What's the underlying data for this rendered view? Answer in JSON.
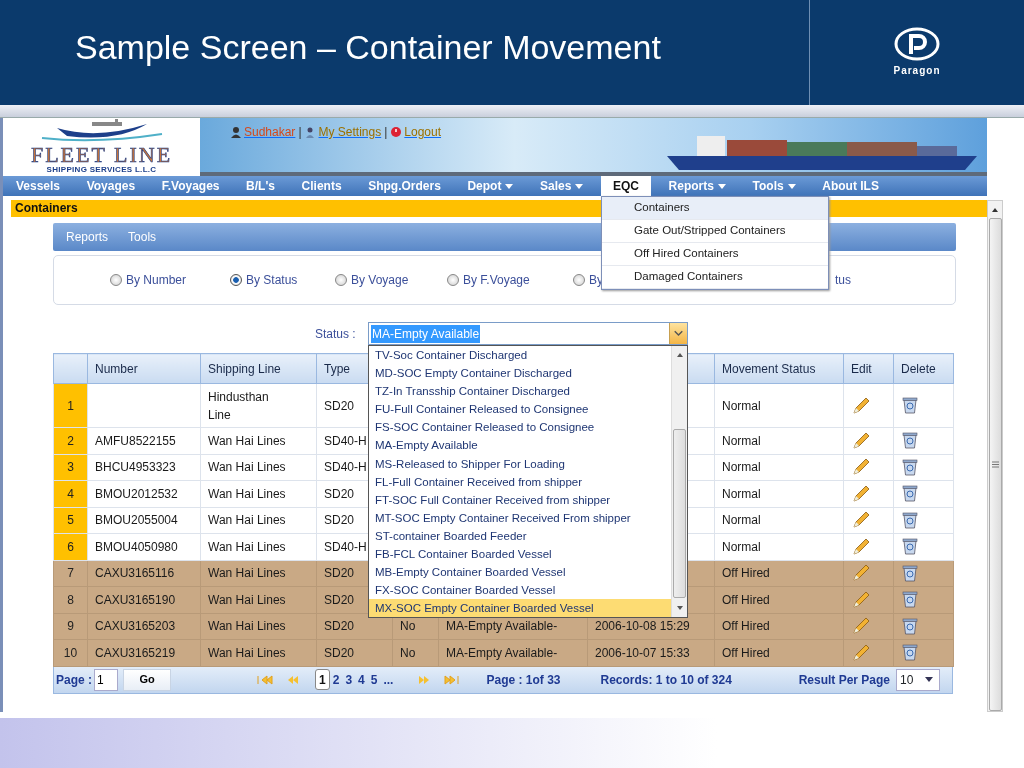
{
  "slide": {
    "title": "Sample Screen – Container Movement",
    "logo_text": "Paragon"
  },
  "app": {
    "logo": {
      "name": "FLEET LINE",
      "tagline": "SHIPPING SERVICES L.L.C"
    },
    "user_links": [
      {
        "kind": "user",
        "label": "Sudhakar"
      },
      {
        "kind": "separator",
        "label": "|"
      },
      {
        "kind": "settings",
        "label": "My Settings"
      },
      {
        "kind": "separator",
        "label": "|"
      },
      {
        "kind": "logout",
        "label": "Logout"
      }
    ],
    "nav": [
      {
        "label": "Vessels",
        "dropdown": false,
        "selected": false
      },
      {
        "label": "Voyages",
        "dropdown": false,
        "selected": false
      },
      {
        "label": "F.Voyages",
        "dropdown": false,
        "selected": false
      },
      {
        "label": "B/L's",
        "dropdown": false,
        "selected": false
      },
      {
        "label": "Clients",
        "dropdown": false,
        "selected": false
      },
      {
        "label": "Shpg.Orders",
        "dropdown": false,
        "selected": false
      },
      {
        "label": "Depot",
        "dropdown": true,
        "selected": false
      },
      {
        "label": "Sales",
        "dropdown": true,
        "selected": false
      },
      {
        "label": "EQC",
        "dropdown": false,
        "selected": true
      },
      {
        "label": "Reports",
        "dropdown": true,
        "selected": false
      },
      {
        "label": "Tools",
        "dropdown": true,
        "selected": false
      },
      {
        "label": "About ILS",
        "dropdown": false,
        "selected": false
      }
    ],
    "eqc_menu": [
      {
        "label": "Containers",
        "highlighted": true
      },
      {
        "label": "Gate Out/Stripped Containers",
        "highlighted": false
      },
      {
        "label": "Off Hired Containers",
        "highlighted": false
      },
      {
        "label": "Damaged Containers",
        "highlighted": false
      }
    ],
    "section_title": "Containers",
    "toolbar": [
      "Reports",
      "Tools"
    ],
    "search_by": [
      {
        "kind": "radio",
        "label": "By Number",
        "selected": false
      },
      {
        "kind": "radio",
        "label": "By Status",
        "selected": true
      },
      {
        "kind": "radio",
        "label": "By Voyage",
        "selected": false
      },
      {
        "kind": "radio",
        "label": "By F.Voyage",
        "selected": false
      },
      {
        "kind": "radio",
        "label": "By",
        "selected": false
      },
      {
        "kind": "text",
        "label": "tus"
      }
    ],
    "status_filter": {
      "label": "Status :",
      "value": "MA-Empty Available",
      "options": [
        {
          "label": "TV-Soc Container Discharged",
          "highlighted": false
        },
        {
          "label": "MD-SOC Empty Container Discharged",
          "highlighted": false
        },
        {
          "label": "TZ-In Transship Container Discharged",
          "highlighted": false
        },
        {
          "label": "FU-Full Container Released to Consignee",
          "highlighted": false
        },
        {
          "label": "FS-SOC Container Released to Consignee",
          "highlighted": false
        },
        {
          "label": "MA-Empty Available",
          "highlighted": false
        },
        {
          "label": "MS-Released to Shipper For Loading",
          "highlighted": false
        },
        {
          "label": "FL-Full Container Received from shipper",
          "highlighted": false
        },
        {
          "label": "FT-SOC Full Container Received from shipper",
          "highlighted": false
        },
        {
          "label": "MT-SOC Empty Container Received From shipper",
          "highlighted": false
        },
        {
          "label": "ST-container Boarded Feeder",
          "highlighted": false
        },
        {
          "label": "FB-FCL Container Boarded Vessel",
          "highlighted": false
        },
        {
          "label": "MB-Empty Container Boarded Vessel",
          "highlighted": false
        },
        {
          "label": "FX-SOC Container Boarded Vessel",
          "highlighted": false
        },
        {
          "label": "MX-SOC Empty Container Boarded Vessel",
          "highlighted": true
        }
      ]
    },
    "table": {
      "columns": {
        "number": "Number",
        "shipping_line": "Shipping Line",
        "type": "Type",
        "movement_status": "Movement Status",
        "edit": "Edit",
        "delete": "Delete"
      },
      "rows": [
        {
          "index": "1",
          "shipping_line": "Hindusthan Line",
          "type": "SD20",
          "movement_status": "Normal",
          "off_hired": false
        },
        {
          "index": "2",
          "number": "AMFU8522155",
          "shipping_line": "Wan Hai Lines",
          "type": "SD40-H",
          "movement_status": "Normal",
          "off_hired": false
        },
        {
          "index": "3",
          "number": "BHCU4953323",
          "shipping_line": "Wan Hai Lines",
          "type": "SD40-H",
          "movement_status": "Normal",
          "off_hired": false
        },
        {
          "index": "4",
          "number": "BMOU2012532",
          "shipping_line": "Wan Hai Lines",
          "type": "SD20",
          "movement_status": "Normal",
          "off_hired": false
        },
        {
          "index": "5",
          "number": "BMOU2055004",
          "shipping_line": "Wan Hai Lines",
          "type": "SD20",
          "movement_status": "Normal",
          "off_hired": false
        },
        {
          "index": "6",
          "number": "BMOU4050980",
          "shipping_line": "Wan Hai Lines",
          "type": "SD40-H",
          "movement_status": "Normal",
          "off_hired": false
        },
        {
          "index": "7",
          "number": "CAXU3165116",
          "shipping_line": "Wan Hai Lines",
          "type": "SD20",
          "movement_status": "Off Hired",
          "off_hired": true
        },
        {
          "index": "8",
          "number": "CAXU3165190",
          "shipping_line": "Wan Hai Lines",
          "type": "SD20",
          "movement_status": "Off Hired",
          "off_hired": true
        },
        {
          "index": "9",
          "number": "CAXU3165203",
          "shipping_line": "Wan Hai Lines",
          "type": "SD20",
          "column_5": "No",
          "column_6": "MA-Empty Available-",
          "column_7": "2006-10-08 15:29",
          "movement_status": "Off Hired",
          "off_hired": true
        },
        {
          "index": "10",
          "number": "CAXU3165219",
          "shipping_line": "Wan Hai Lines",
          "type": "SD20",
          "column_5": "No",
          "column_6": "MA-Empty Available-",
          "column_7": "2006-10-07 15:33",
          "movement_status": "Off Hired",
          "off_hired": true
        }
      ]
    },
    "pager": {
      "page_label": "Page :",
      "page_value": "1",
      "go": "Go",
      "pages": [
        {
          "label": "1",
          "selected": true
        },
        {
          "label": "2",
          "selected": false
        },
        {
          "label": "3",
          "selected": false
        },
        {
          "label": "4",
          "selected": false
        },
        {
          "label": "5",
          "selected": false
        },
        {
          "label": "...",
          "selected": false
        }
      ],
      "page_info": "Page : 1of 33",
      "records": "Records: 1 to 10 of 324",
      "per_page_label": "Result Per Page",
      "per_page": "10"
    }
  }
}
